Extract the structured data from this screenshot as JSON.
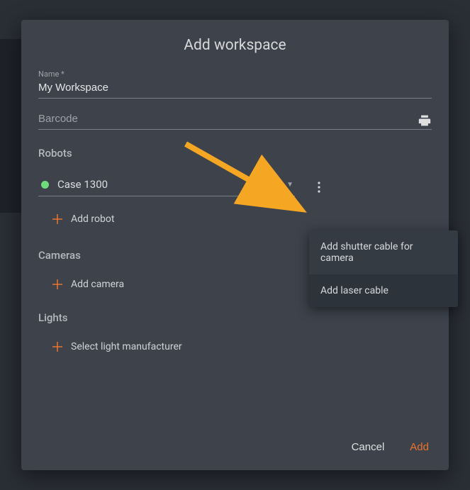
{
  "dialog": {
    "title": "Add workspace",
    "name_field": {
      "label": "Name *",
      "value": "My Workspace"
    },
    "barcode_field": {
      "placeholder": "Barcode",
      "value": ""
    }
  },
  "sections": {
    "robots": {
      "header": "Robots",
      "selected": "Case 1300",
      "add_label": "Add robot"
    },
    "cameras": {
      "header": "Cameras",
      "add_label": "Add camera"
    },
    "lights": {
      "header": "Lights",
      "add_label": "Select light manufacturer"
    }
  },
  "actions": {
    "cancel": "Cancel",
    "add": "Add"
  },
  "context_menu": {
    "items": [
      "Add shutter cable for camera",
      "Add laser cable"
    ]
  },
  "colors": {
    "accent": "#e8742e",
    "status_online": "#6edc7a"
  }
}
